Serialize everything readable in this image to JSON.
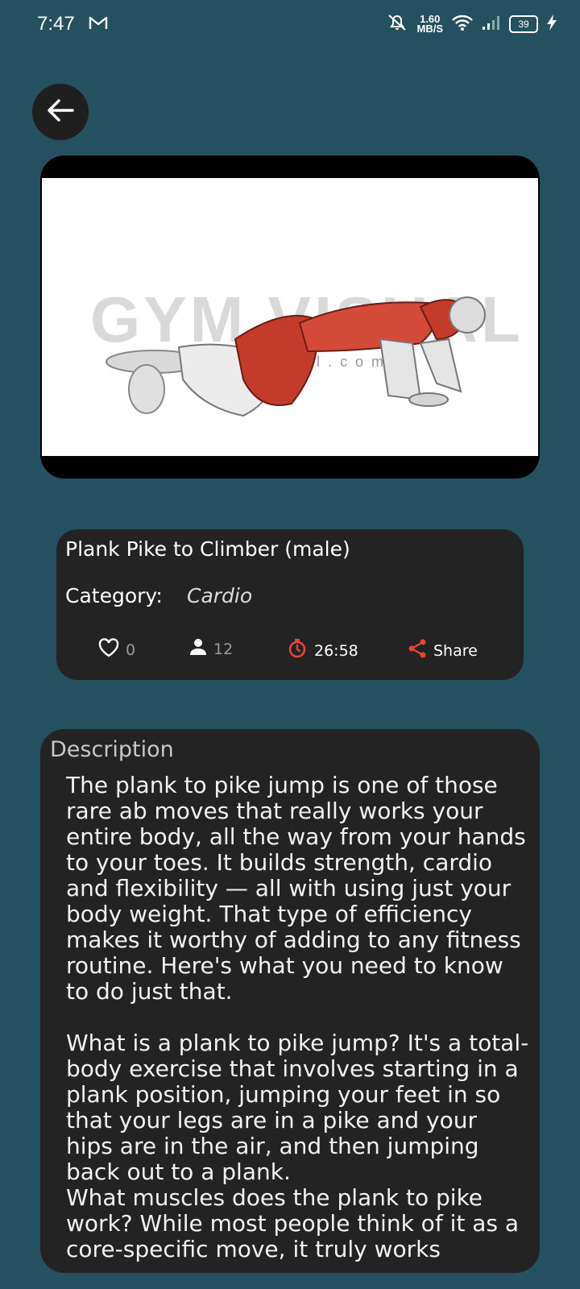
{
  "status_bar": {
    "time": "7:47",
    "net_speed_value": "1.60",
    "net_speed_unit": "MB/S",
    "battery": "39"
  },
  "exercise": {
    "title": "Plank Pike to Climber (male)",
    "category_label": "Category:",
    "category_value": "Cardio",
    "likes": "0",
    "users": "12",
    "timer": "26:58",
    "share_label": "Share"
  },
  "media": {
    "watermark": "GYM VISUAL",
    "watermark_sub": "gymvisual.com"
  },
  "description": {
    "heading": "Description",
    "text": "The plank to pike jump is one of those rare ab moves that really works your entire body, all the way from your hands to your toes. It builds strength, cardio and flexibility — all with using just your body weight. That type of efficiency makes it worthy of adding to any fitness routine. Here's what you need to know to do just that.\n\nWhat is a plank to pike jump? It's a total-body exercise that involves starting in a plank position, jumping your feet in so that your legs are in a pike and your hips are in the air, and then jumping back out to a plank.\nWhat muscles does the plank to pike work? While most people think of it as a core-specific move, it truly works"
  },
  "colors": {
    "background": "#24505f",
    "card": "#232323",
    "accent_red": "#e8443a"
  },
  "icons": [
    "back-arrow-icon",
    "gmail-icon",
    "mute-icon",
    "wifi-icon",
    "signal-icon",
    "battery-icon",
    "charging-icon",
    "heart-icon",
    "person-icon",
    "timer-icon",
    "share-icon"
  ]
}
